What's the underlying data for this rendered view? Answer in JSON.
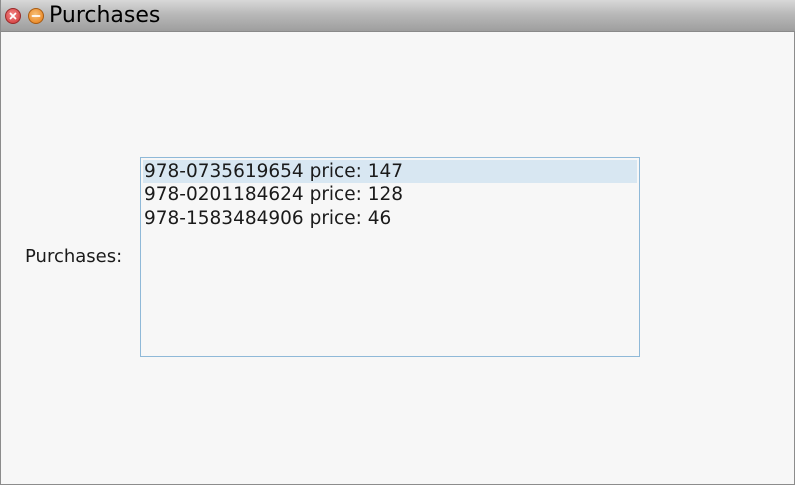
{
  "window": {
    "title": "Purchases"
  },
  "form": {
    "label": "Purchases:"
  },
  "purchases_list": {
    "selected_index": 0,
    "items": [
      {
        "text": "978-0735619654 price: 147"
      },
      {
        "text": "978-0201184624 price: 128"
      },
      {
        "text": "978-1583484906 price: 46"
      }
    ]
  },
  "colors": {
    "selection": "#d8e7f2",
    "list_border": "#8fb9d8",
    "close_button": "#d84a4a",
    "minimize_button": "#ec8e2e"
  },
  "icons": {
    "close": "close-icon",
    "minimize": "minimize-icon"
  }
}
